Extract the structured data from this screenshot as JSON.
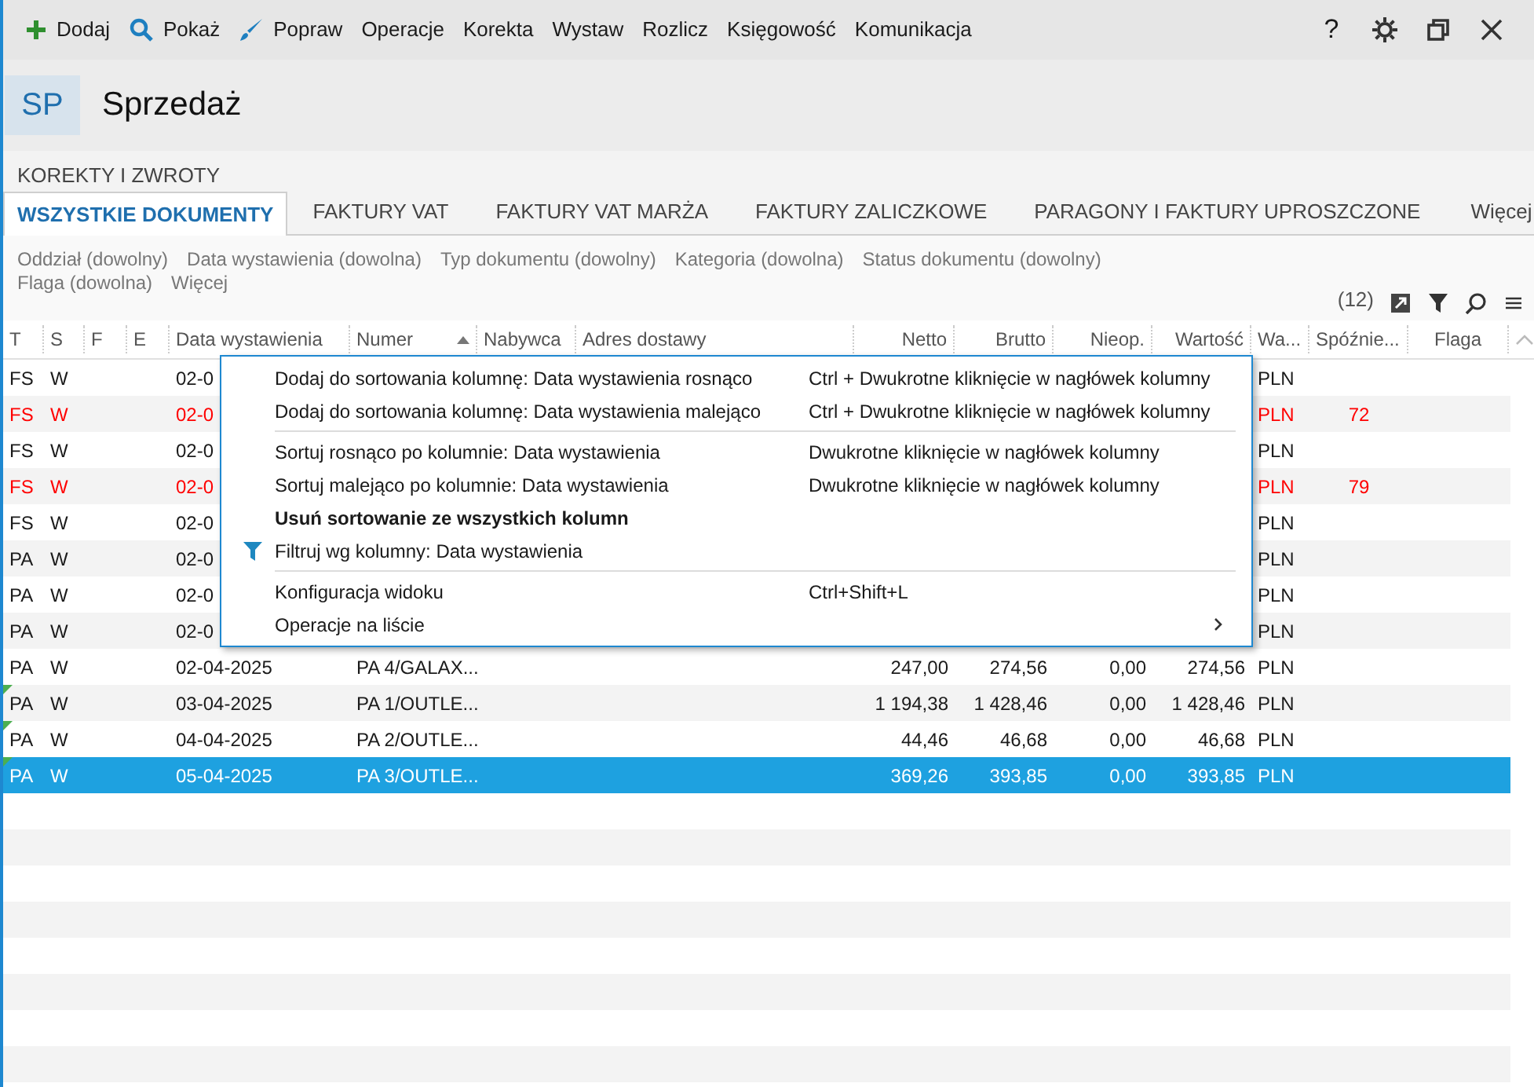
{
  "toolbar": {
    "buttons": [
      {
        "label": "Dodaj",
        "kind": "add"
      },
      {
        "label": "Pokaż",
        "kind": "search"
      },
      {
        "label": "Popraw",
        "kind": "brush"
      },
      {
        "label": "Operacje",
        "kind": "text"
      },
      {
        "label": "Korekta",
        "kind": "text"
      },
      {
        "label": "Wystaw",
        "kind": "text"
      },
      {
        "label": "Rozlicz",
        "kind": "text"
      },
      {
        "label": "Księgowość",
        "kind": "text"
      },
      {
        "label": "Komunikacja",
        "kind": "text"
      }
    ],
    "help": "?"
  },
  "header": {
    "badge": "SP",
    "title": "Sprzedaż"
  },
  "section_label": "KOREKTY I ZWROTY",
  "tabs": [
    {
      "label": "WSZYSTKIE DOKUMENTY",
      "selected": true
    },
    {
      "label": "FAKTURY VAT",
      "selected": false
    },
    {
      "label": "FAKTURY VAT MARŻA",
      "selected": false
    },
    {
      "label": "FAKTURY ZALICZKOWE",
      "selected": false
    },
    {
      "label": "PARAGONY I FAKTURY UPROSZCZONE",
      "selected": false
    }
  ],
  "tabs_more": "Więcej",
  "filters": [
    "Oddział (dowolny)",
    "Data wystawienia (dowolna)",
    "Typ dokumentu (dowolny)",
    "Kategoria (dowolna)",
    "Status dokumentu (dowolny)",
    "Flaga (dowolna)",
    "Więcej"
  ],
  "count": "(12)",
  "table": {
    "columns": [
      {
        "label": "T"
      },
      {
        "label": "S"
      },
      {
        "label": "F"
      },
      {
        "label": "E"
      },
      {
        "label": "Data wystawienia"
      },
      {
        "label": "Numer",
        "sorted": true
      },
      {
        "label": "Nabywca"
      },
      {
        "label": "Adres dostawy"
      },
      {
        "label": "Netto"
      },
      {
        "label": "Brutto"
      },
      {
        "label": "Nieop."
      },
      {
        "label": "Wartość"
      },
      {
        "label": "Wa..."
      },
      {
        "label": "Spóźnie..."
      },
      {
        "label": "Flaga"
      }
    ],
    "rows": [
      {
        "t": "FS",
        "s": "W",
        "date": "02-0",
        "currency": "PLN",
        "late": "",
        "overdue": false,
        "marker": false,
        "selected": false
      },
      {
        "t": "FS",
        "s": "W",
        "date": "02-0",
        "currency": "PLN",
        "late": "72",
        "overdue": true,
        "marker": false,
        "selected": false
      },
      {
        "t": "FS",
        "s": "W",
        "date": "02-0",
        "currency": "PLN",
        "late": "",
        "overdue": false,
        "marker": false,
        "selected": false
      },
      {
        "t": "FS",
        "s": "W",
        "date": "02-0",
        "currency": "PLN",
        "late": "79",
        "overdue": true,
        "marker": false,
        "selected": false
      },
      {
        "t": "FS",
        "s": "W",
        "date": "02-0",
        "currency": "PLN",
        "late": "",
        "overdue": false,
        "marker": false,
        "selected": false
      },
      {
        "t": "PA",
        "s": "W",
        "date": "02-0",
        "currency": "PLN",
        "late": "",
        "overdue": false,
        "marker": false,
        "selected": false
      },
      {
        "t": "PA",
        "s": "W",
        "date": "02-0",
        "currency": "PLN",
        "late": "",
        "overdue": false,
        "marker": false,
        "selected": false
      },
      {
        "t": "PA",
        "s": "W",
        "date": "02-0",
        "currency": "PLN",
        "late": "",
        "overdue": false,
        "marker": false,
        "selected": false
      },
      {
        "t": "PA",
        "s": "W",
        "date": "02-04-2025",
        "number": "PA 4/GALAX...",
        "netto": "247,00",
        "brutto": "274,56",
        "nieop": "0,00",
        "wartosc": "274,56",
        "currency": "PLN",
        "late": "",
        "overdue": false,
        "marker": false,
        "selected": false
      },
      {
        "t": "PA",
        "s": "W",
        "date": "03-04-2025",
        "number": "PA 1/OUTLE...",
        "netto": "1 194,38",
        "brutto": "1 428,46",
        "nieop": "0,00",
        "wartosc": "1 428,46",
        "currency": "PLN",
        "late": "",
        "overdue": false,
        "marker": true,
        "selected": false
      },
      {
        "t": "PA",
        "s": "W",
        "date": "04-04-2025",
        "number": "PA 2/OUTLE...",
        "netto": "44,46",
        "brutto": "46,68",
        "nieop": "0,00",
        "wartosc": "46,68",
        "currency": "PLN",
        "late": "",
        "overdue": false,
        "marker": true,
        "selected": false
      },
      {
        "t": "PA",
        "s": "W",
        "date": "05-04-2025",
        "number": "PA 3/OUTLE...",
        "netto": "369,26",
        "brutto": "393,85",
        "nieop": "0,00",
        "wartosc": "393,85",
        "currency": "PLN",
        "late": "",
        "overdue": false,
        "marker": true,
        "selected": true
      }
    ]
  },
  "context_menu": {
    "items": [
      {
        "label": "Dodaj do sortowania kolumnę: Data wystawienia rosnąco",
        "shortcut": "Ctrl + Dwukrotne kliknięcie w nagłówek kolumny",
        "kind": "plain"
      },
      {
        "label": "Dodaj do sortowania kolumnę: Data wystawienia malejąco",
        "shortcut": "Ctrl + Dwukrotne kliknięcie w nagłówek kolumny",
        "kind": "plain"
      },
      {
        "kind": "separator"
      },
      {
        "label": "Sortuj rosnąco po kolumnie: Data wystawienia",
        "shortcut": "Dwukrotne kliknięcie w nagłówek kolumny",
        "kind": "plain"
      },
      {
        "label": "Sortuj malejąco po kolumnie: Data wystawienia",
        "shortcut": "Dwukrotne kliknięcie w nagłówek kolumny",
        "kind": "plain"
      },
      {
        "label": "Usuń sortowanie ze wszystkich kolumn",
        "kind": "plain"
      },
      {
        "label": "Filtruj wg kolumny: Data wystawienia",
        "kind": "filter"
      },
      {
        "kind": "separator"
      },
      {
        "label": "Konfiguracja widoku",
        "shortcut": "Ctrl+Shift+L",
        "kind": "plain"
      },
      {
        "label": "Operacje na liście",
        "kind": "submenu"
      }
    ]
  }
}
